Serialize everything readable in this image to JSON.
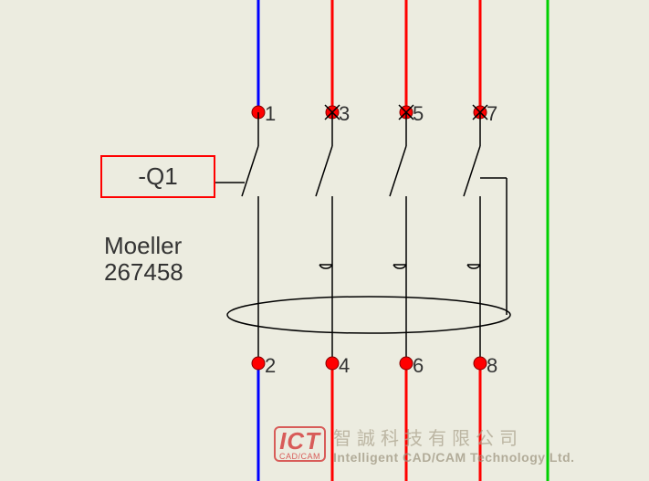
{
  "component": {
    "designator": "-Q1",
    "manufacturer": "Moeller",
    "part_number": "267458"
  },
  "terminals": {
    "top": [
      "1",
      "3",
      "5",
      "7"
    ],
    "bottom": [
      "2",
      "4",
      "6",
      "8"
    ]
  },
  "wires": {
    "colors": [
      "#0000ff",
      "#ff0000",
      "#ff0000",
      "#ff0000",
      "#00d000"
    ]
  },
  "logo": {
    "short": "ICT",
    "sub": "CAD/CAM",
    "cn": "智誠科技有限公司",
    "en": "Intelligent CAD/CAM Technology Ltd."
  }
}
